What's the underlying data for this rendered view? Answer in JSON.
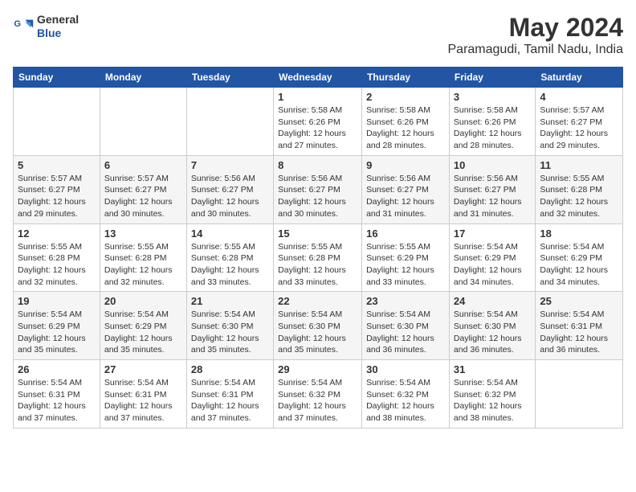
{
  "header": {
    "logo_line1": "General",
    "logo_line2": "Blue",
    "title": "May 2024",
    "subtitle": "Paramagudi, Tamil Nadu, India"
  },
  "calendar": {
    "headers": [
      "Sunday",
      "Monday",
      "Tuesday",
      "Wednesday",
      "Thursday",
      "Friday",
      "Saturday"
    ],
    "weeks": [
      [
        {
          "day": "",
          "info": ""
        },
        {
          "day": "",
          "info": ""
        },
        {
          "day": "",
          "info": ""
        },
        {
          "day": "1",
          "info": "Sunrise: 5:58 AM\nSunset: 6:26 PM\nDaylight: 12 hours\nand 27 minutes."
        },
        {
          "day": "2",
          "info": "Sunrise: 5:58 AM\nSunset: 6:26 PM\nDaylight: 12 hours\nand 28 minutes."
        },
        {
          "day": "3",
          "info": "Sunrise: 5:58 AM\nSunset: 6:26 PM\nDaylight: 12 hours\nand 28 minutes."
        },
        {
          "day": "4",
          "info": "Sunrise: 5:57 AM\nSunset: 6:27 PM\nDaylight: 12 hours\nand 29 minutes."
        }
      ],
      [
        {
          "day": "5",
          "info": "Sunrise: 5:57 AM\nSunset: 6:27 PM\nDaylight: 12 hours\nand 29 minutes."
        },
        {
          "day": "6",
          "info": "Sunrise: 5:57 AM\nSunset: 6:27 PM\nDaylight: 12 hours\nand 30 minutes."
        },
        {
          "day": "7",
          "info": "Sunrise: 5:56 AM\nSunset: 6:27 PM\nDaylight: 12 hours\nand 30 minutes."
        },
        {
          "day": "8",
          "info": "Sunrise: 5:56 AM\nSunset: 6:27 PM\nDaylight: 12 hours\nand 30 minutes."
        },
        {
          "day": "9",
          "info": "Sunrise: 5:56 AM\nSunset: 6:27 PM\nDaylight: 12 hours\nand 31 minutes."
        },
        {
          "day": "10",
          "info": "Sunrise: 5:56 AM\nSunset: 6:27 PM\nDaylight: 12 hours\nand 31 minutes."
        },
        {
          "day": "11",
          "info": "Sunrise: 5:55 AM\nSunset: 6:28 PM\nDaylight: 12 hours\nand 32 minutes."
        }
      ],
      [
        {
          "day": "12",
          "info": "Sunrise: 5:55 AM\nSunset: 6:28 PM\nDaylight: 12 hours\nand 32 minutes."
        },
        {
          "day": "13",
          "info": "Sunrise: 5:55 AM\nSunset: 6:28 PM\nDaylight: 12 hours\nand 32 minutes."
        },
        {
          "day": "14",
          "info": "Sunrise: 5:55 AM\nSunset: 6:28 PM\nDaylight: 12 hours\nand 33 minutes."
        },
        {
          "day": "15",
          "info": "Sunrise: 5:55 AM\nSunset: 6:28 PM\nDaylight: 12 hours\nand 33 minutes."
        },
        {
          "day": "16",
          "info": "Sunrise: 5:55 AM\nSunset: 6:29 PM\nDaylight: 12 hours\nand 33 minutes."
        },
        {
          "day": "17",
          "info": "Sunrise: 5:54 AM\nSunset: 6:29 PM\nDaylight: 12 hours\nand 34 minutes."
        },
        {
          "day": "18",
          "info": "Sunrise: 5:54 AM\nSunset: 6:29 PM\nDaylight: 12 hours\nand 34 minutes."
        }
      ],
      [
        {
          "day": "19",
          "info": "Sunrise: 5:54 AM\nSunset: 6:29 PM\nDaylight: 12 hours\nand 35 minutes."
        },
        {
          "day": "20",
          "info": "Sunrise: 5:54 AM\nSunset: 6:29 PM\nDaylight: 12 hours\nand 35 minutes."
        },
        {
          "day": "21",
          "info": "Sunrise: 5:54 AM\nSunset: 6:30 PM\nDaylight: 12 hours\nand 35 minutes."
        },
        {
          "day": "22",
          "info": "Sunrise: 5:54 AM\nSunset: 6:30 PM\nDaylight: 12 hours\nand 35 minutes."
        },
        {
          "day": "23",
          "info": "Sunrise: 5:54 AM\nSunset: 6:30 PM\nDaylight: 12 hours\nand 36 minutes."
        },
        {
          "day": "24",
          "info": "Sunrise: 5:54 AM\nSunset: 6:30 PM\nDaylight: 12 hours\nand 36 minutes."
        },
        {
          "day": "25",
          "info": "Sunrise: 5:54 AM\nSunset: 6:31 PM\nDaylight: 12 hours\nand 36 minutes."
        }
      ],
      [
        {
          "day": "26",
          "info": "Sunrise: 5:54 AM\nSunset: 6:31 PM\nDaylight: 12 hours\nand 37 minutes."
        },
        {
          "day": "27",
          "info": "Sunrise: 5:54 AM\nSunset: 6:31 PM\nDaylight: 12 hours\nand 37 minutes."
        },
        {
          "day": "28",
          "info": "Sunrise: 5:54 AM\nSunset: 6:31 PM\nDaylight: 12 hours\nand 37 minutes."
        },
        {
          "day": "29",
          "info": "Sunrise: 5:54 AM\nSunset: 6:32 PM\nDaylight: 12 hours\nand 37 minutes."
        },
        {
          "day": "30",
          "info": "Sunrise: 5:54 AM\nSunset: 6:32 PM\nDaylight: 12 hours\nand 38 minutes."
        },
        {
          "day": "31",
          "info": "Sunrise: 5:54 AM\nSunset: 6:32 PM\nDaylight: 12 hours\nand 38 minutes."
        },
        {
          "day": "",
          "info": ""
        }
      ]
    ]
  }
}
